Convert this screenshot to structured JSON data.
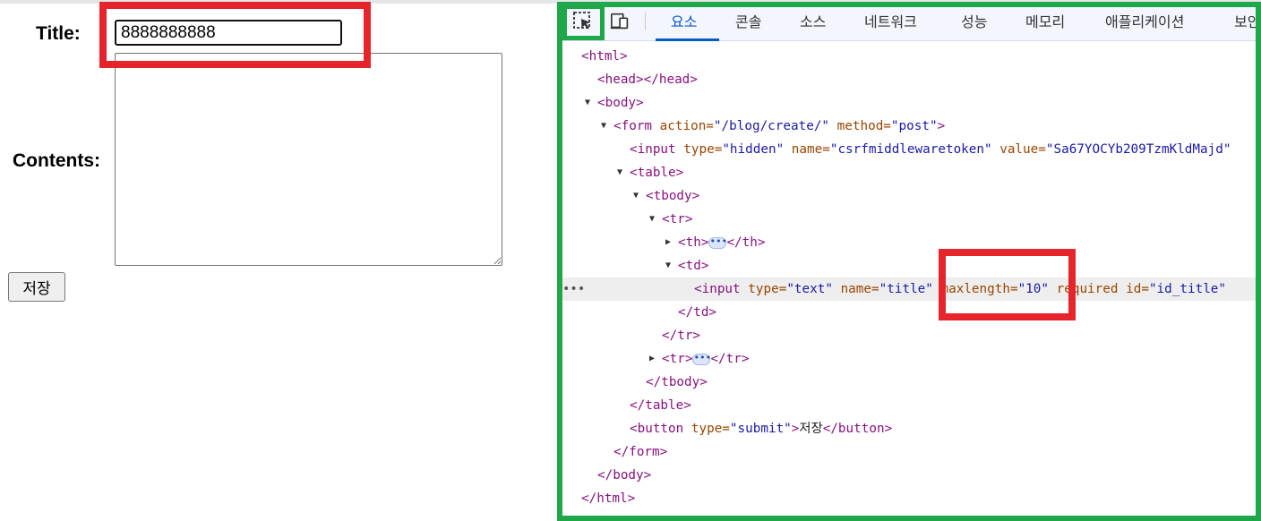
{
  "form": {
    "title_label": "Title:",
    "title_value": "8888888888",
    "contents_label": "Contents:",
    "contents_value": "",
    "save_label": "저장"
  },
  "devtools": {
    "tabs": [
      {
        "label": "요소",
        "active": true
      },
      {
        "label": "콘솔"
      },
      {
        "label": "소스"
      },
      {
        "label": "네트워크"
      },
      {
        "label": "성능"
      },
      {
        "label": "메모리"
      },
      {
        "label": "애플리케이션"
      },
      {
        "label": "보안"
      }
    ],
    "icons": {
      "select": "inspect-element-icon",
      "device": "device-toolbar-icon"
    },
    "dom": {
      "html_open": "<html>",
      "head": "<head></head>",
      "body_open": "<body>",
      "form_tag": "<form",
      "form_action_attr": "action=",
      "form_action_val": "\"/blog/create/\"",
      "form_method_attr": "method=",
      "form_method_val": "\"post\"",
      "gt": ">",
      "input_tag": "<input",
      "hidden_type_attr": "type=",
      "hidden_type_val": "\"hidden\"",
      "hidden_name_attr": "name=",
      "hidden_name_val": "\"csrfmiddlewaretoken\"",
      "hidden_value_attr": "value=",
      "hidden_value_val": "\"Sa67YOCYb209TzmKldMajd\"",
      "table_open": "<table>",
      "tbody_open": "<tbody>",
      "tr_open": "<tr>",
      "th_open": "<th>",
      "th_close": "</th>",
      "ellipsis": "•••",
      "td_open": "<td>",
      "text_type_attr": "type=",
      "text_type_val": "\"text\"",
      "text_name_attr": "name=",
      "text_name_val": "\"title\"",
      "maxlength_attr": "maxlength=",
      "maxlength_val": "\"10\"",
      "required_attr": "required",
      "id_attr": "id=",
      "id_val": "\"id_title\"",
      "td_close": "</td>",
      "tr_close": "</tr>",
      "tbody_close": "</tbody>",
      "table_close": "</table>",
      "button_tag": "<button",
      "button_type_attr": "type=",
      "button_type_val": "\"submit\"",
      "button_text": "저장",
      "button_close": "</button>",
      "form_close": "</form>",
      "body_close": "</body>",
      "html_close": "</html>",
      "gutter": "•••"
    }
  },
  "colors": {
    "annotation_red": "#e6242c",
    "annotation_green": "#1fa84a",
    "tag": "#881280",
    "attr_name": "#994500",
    "attr_value": "#1a1aa6",
    "active_tab": "#0b57d0"
  }
}
